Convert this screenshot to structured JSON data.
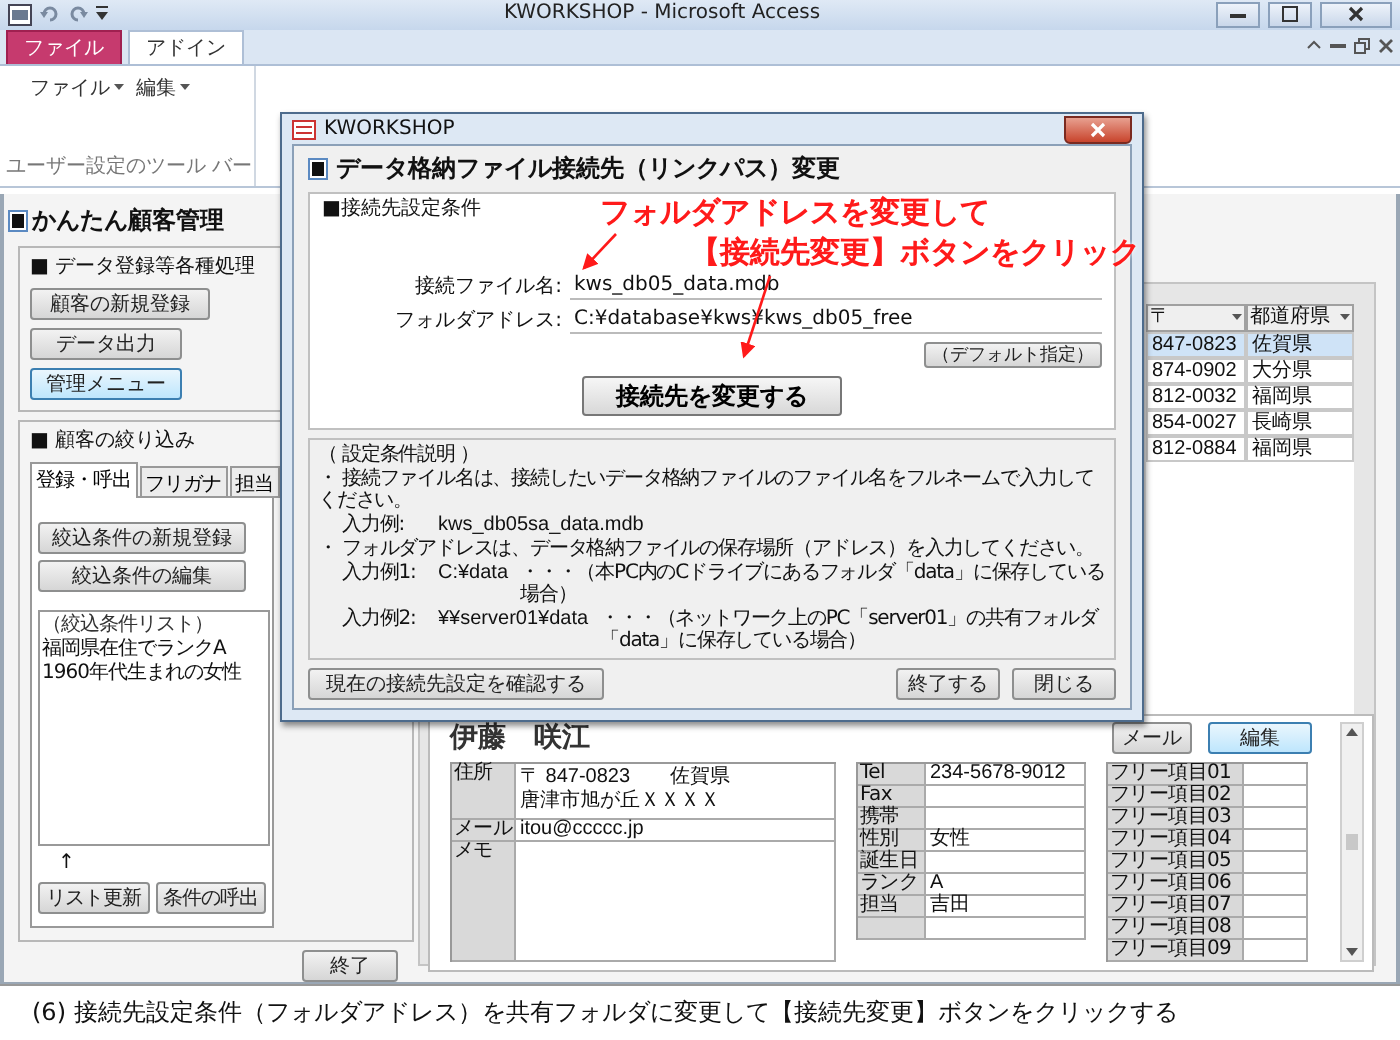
{
  "window": {
    "title": "KWORKSHOP - Microsoft Access"
  },
  "ribbon": {
    "tabs": [
      {
        "label": "ファイル",
        "kind": "backstage",
        "selected": false
      },
      {
        "label": "アドイン",
        "kind": "tab",
        "selected": true
      }
    ],
    "menus": [
      {
        "label": "ファイル"
      },
      {
        "label": "編集"
      }
    ],
    "group_label": "ユーザー設定のツール バー"
  },
  "form": {
    "title": "かんたん顧客管理",
    "processing": {
      "title": "■ データ登録等各種処理",
      "buttons": [
        {
          "label": "顧客の新規登録",
          "focused": false
        },
        {
          "label": "データ出力",
          "focused": false
        },
        {
          "label": "管理メニュー",
          "focused": true
        }
      ]
    },
    "filter": {
      "title": "■ 顧客の絞り込み",
      "tabs": [
        {
          "label": "登録・呼出",
          "selected": true
        },
        {
          "label": "フリガナ",
          "selected": false
        },
        {
          "label": "担当",
          "selected": false
        }
      ],
      "buttons": [
        "絞込条件の新規登録",
        "絞込条件の編集"
      ],
      "list": {
        "header": "（絞込条件リスト）",
        "items": [
          "福岡県在住でランクA",
          "1960年代生まれの女性"
        ]
      },
      "arrow": "↑",
      "bottom_buttons": [
        "リスト更新",
        "条件の呼出"
      ]
    },
    "close_button": "終了",
    "table": {
      "columns": [
        "〒",
        "都道府県"
      ],
      "rows": [
        {
          "cells": [
            "847-0823",
            "佐賀県"
          ],
          "selected": true
        },
        {
          "cells": [
            "874-0902",
            "大分県"
          ],
          "selected": false
        },
        {
          "cells": [
            "812-0032",
            "福岡県"
          ],
          "selected": false
        },
        {
          "cells": [
            "854-0027",
            "長崎県"
          ],
          "selected": false
        },
        {
          "cells": [
            "812-0884",
            "福岡県"
          ],
          "selected": false
        }
      ]
    },
    "detail": {
      "name": "伊藤　咲江",
      "buttons": [
        "メール",
        "編集"
      ],
      "address": {
        "label": "住所",
        "lines": [
          "〒 847-0823　　佐賀県",
          "唐津市旭が丘ＸＸＸＸ"
        ]
      },
      "mail": {
        "label": "メール",
        "value": "itou@ccccc.jp"
      },
      "memo": {
        "label": "メモ"
      },
      "fields": [
        {
          "label": "Tel",
          "value": "234-5678-9012"
        },
        {
          "label": "Fax"
        },
        {
          "label": "携帯"
        },
        {
          "label": "性別",
          "value": "女性"
        },
        {
          "label": "誕生日"
        },
        {
          "label": "ランク",
          "value": "A"
        },
        {
          "label": "担当",
          "value": "吉田"
        }
      ],
      "free_items": [
        "フリー項目01",
        "フリー項目02",
        "フリー項目03",
        "フリー項目04",
        "フリー項目05",
        "フリー項目06",
        "フリー項目07",
        "フリー項目08",
        "フリー項目09"
      ]
    }
  },
  "dialog": {
    "title": "KWORKSHOP",
    "heading": "データ格納ファイル接続先（リンクパス）変更",
    "conditions": {
      "title": "■接続先設定条件",
      "fields": [
        {
          "label": "接続ファイル名:",
          "value": "kws_db05_data.mdb"
        },
        {
          "label": "フォルダアドレス:",
          "value": "C:¥database¥kws¥kws_db05_free"
        }
      ],
      "default_button": "（デフォルト指定）",
      "connect_button": "接続先を変更する"
    },
    "explanation": {
      "title": "（ 設定条件説明 ）",
      "items": [
        {
          "text": "・ 接続ファイル名は、接続したいデータ格納ファイルのファイル名をフルネームで入力してください。",
          "examples": [
            {
              "label": "入力例:",
              "value": "kws_db05sa_data.mdb"
            }
          ]
        },
        {
          "text": "・ フォルダアドレスは、データ格納ファイルの保存場所（アドレス）を入力してください。",
          "examples": [
            {
              "label": "入力例1:",
              "value": "C:¥data",
              "note": "・・・（本PC内のCドライブにあるフォルダ「data」に保存している場合）"
            },
            {
              "label": "入力例2:",
              "value": "¥¥server01¥data",
              "note": "・・・（ネットワーク上のPC「server01」の共有フォルダ「data」に保存している場合）"
            }
          ]
        }
      ]
    },
    "buttons": [
      {
        "label": "現在の接続先設定を確認する",
        "kind": "left"
      },
      {
        "label": "終了する",
        "kind": "right"
      },
      {
        "label": "閉じる",
        "kind": "right"
      }
    ]
  },
  "annotation": {
    "lines": [
      "フォルダアドレスを変更して",
      "【接続先変更】ボタンをクリック"
    ]
  },
  "caption": "(6) 接続先設定条件（フォルダアドレス）を共有フォルダに変更して【接続先変更】ボタンをクリックする"
}
